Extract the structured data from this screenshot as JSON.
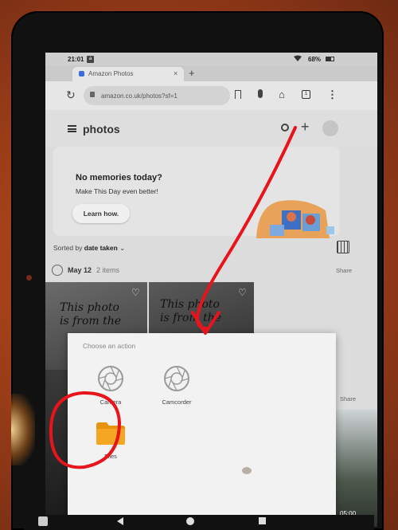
{
  "status_bar": {
    "time": "21:01",
    "notification_badge": "a",
    "battery_percent": "68%"
  },
  "browser": {
    "tab_title": "Amazon Photos",
    "tab_close": "×",
    "new_tab": "+",
    "url": "amazon.co.uk/photos?sf=1",
    "tabs_count": "1",
    "reload_glyph": "↻",
    "home_glyph": "⌂",
    "menu_glyph": "⋮"
  },
  "app": {
    "title": "photos",
    "add_glyph": "+"
  },
  "memories": {
    "title": "No memories today?",
    "subtitle": "Make This Day even better!",
    "learn_button": "Learn how."
  },
  "sort": {
    "prefix": "Sorted by ",
    "value": "date taken",
    "chevron": "⌄"
  },
  "date_group": {
    "date": "May 12",
    "count": "2 items",
    "share": "Share",
    "share_2": "Share"
  },
  "thumbnails": [
    {
      "text": "This photo\nis from the"
    },
    {
      "text": "This photo\nis from the"
    }
  ],
  "video": {
    "duration": "05:00"
  },
  "chooser": {
    "title": "Choose an action",
    "options": [
      {
        "label": "Camera",
        "icon": "camera-aperture-icon"
      },
      {
        "label": "Camcorder",
        "icon": "camcorder-aperture-icon"
      },
      {
        "label": "Files",
        "icon": "folder-icon"
      }
    ]
  },
  "annotation": {
    "arrow_color": "#e8141b",
    "circle_color": "#e8141b"
  }
}
